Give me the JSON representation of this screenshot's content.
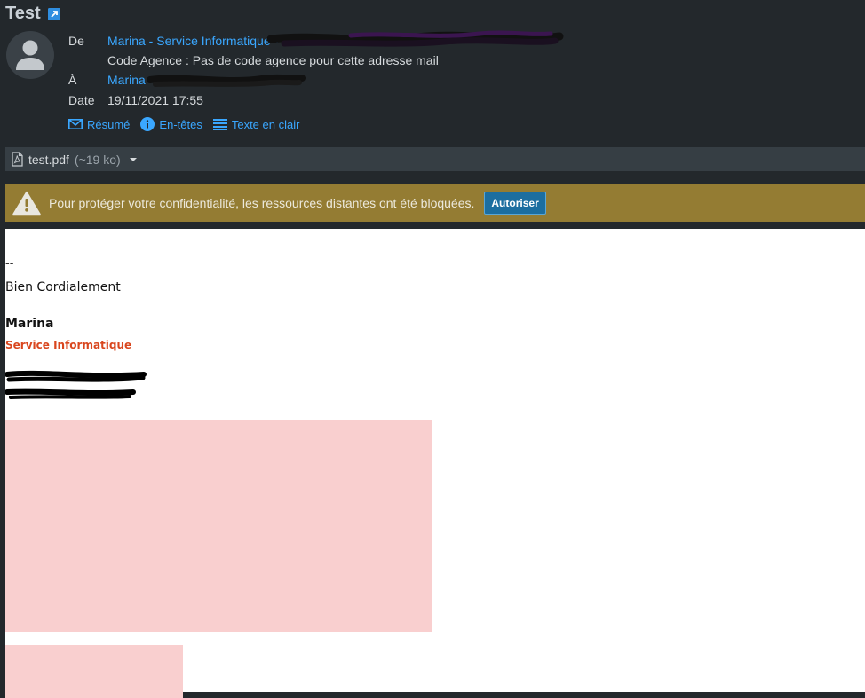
{
  "subject": "Test",
  "headers": {
    "from_label": "De",
    "from_value": "Marina - Service Informatique -",
    "agency_line": "Code Agence : Pas de code agence pour cette adresse mail",
    "to_label": "À",
    "to_value": "Marina",
    "date_label": "Date",
    "date_value": "19/11/2021 17:55"
  },
  "actions": [
    {
      "label": "Résumé",
      "icon": "envelope-icon"
    },
    {
      "label": "En-têtes",
      "icon": "info-icon"
    },
    {
      "label": "Texte en clair",
      "icon": "lines-icon"
    }
  ],
  "attachment": {
    "name": "test.pdf",
    "size": "(~19 ko)",
    "icon": "pdf-file-icon"
  },
  "remote_warning": {
    "message": "Pour protéger votre confidentialité, les ressources distantes ont été bloquées.",
    "button": "Autoriser"
  },
  "signature": {
    "separator": "--",
    "greeting": "Bien Cordialement",
    "name": "Marina",
    "department": "Service Informatique"
  },
  "colors": {
    "background": "#23282c",
    "link": "#3aa7ff",
    "warning_bar": "#947c33",
    "button": "#1c6ea0",
    "department": "#d9461e",
    "image_placeholder": "#f9cfcf"
  }
}
